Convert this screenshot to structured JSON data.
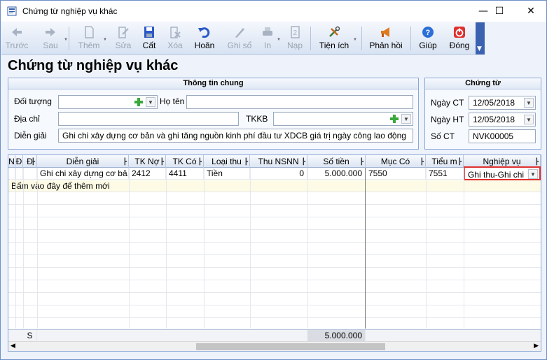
{
  "window": {
    "title": "Chứng từ nghiệp vụ khác",
    "minimize_icon": "minimize-icon",
    "maximize_icon": "maximize-icon",
    "close_icon": "close-icon"
  },
  "toolbar": {
    "back": "Trước",
    "next": "Sau",
    "add": "Thêm",
    "edit": "Sửa",
    "save": "Cất",
    "delete": "Xóa",
    "undo": "Hoãn",
    "post": "Ghi sổ",
    "print": "In",
    "load": "Nạp",
    "utilities": "Tiện ích",
    "feedback": "Phản hồi",
    "help": "Giúp",
    "close": "Đóng"
  },
  "page_title": "Chứng từ nghiệp vụ khác",
  "general": {
    "header": "Thông tin chung",
    "subject_label": "Đối tượng",
    "subject_value": "",
    "name_label": "Họ tên",
    "name_value": "",
    "address_label": "Địa chỉ",
    "address_value": "",
    "tkkb_label": "TKKB",
    "tkkb_value": "",
    "desc_label": "Diễn giải",
    "desc_value": "Ghi chi xây dựng cơ bản và ghi tăng nguồn kinh phí đầu tư XDCB giá trị ngày công lao động"
  },
  "voucher": {
    "header": "Chứng từ",
    "date_ct_label": "Ngày CT",
    "date_ct": "12/05/2018",
    "date_ht_label": "Ngày HT",
    "date_ht": "12/05/2018",
    "no_label": "Số CT",
    "no_value": "NVK00005"
  },
  "grid": {
    "columns": [
      "N",
      "Đ",
      "Đ",
      "Diễn giải",
      "TK Nợ",
      "TK Có",
      "Loại thu",
      "Thu NSNN",
      "Số tiền",
      "Mục Có",
      "Tiểu m",
      "Nghiệp vụ"
    ],
    "rows": [
      {
        "desc": "Ghi chi xây dựng cơ bả...",
        "tk_no": "2412",
        "tk_co": "4411",
        "loai_thu": "Tiền",
        "thu_nsnn": "0",
        "so_tien": "5.000.000",
        "muc_co": "7550",
        "tieu_muc": "7551",
        "nghiep_vu": "Ghi thu-Ghi chi"
      }
    ],
    "add_row_text": "Bấm vào đây để thêm mới",
    "summary_label": "S",
    "summary_total": "5.000.000"
  },
  "colors": {
    "highlight_border": "#e03030",
    "title_accent": "#3a62b0"
  }
}
